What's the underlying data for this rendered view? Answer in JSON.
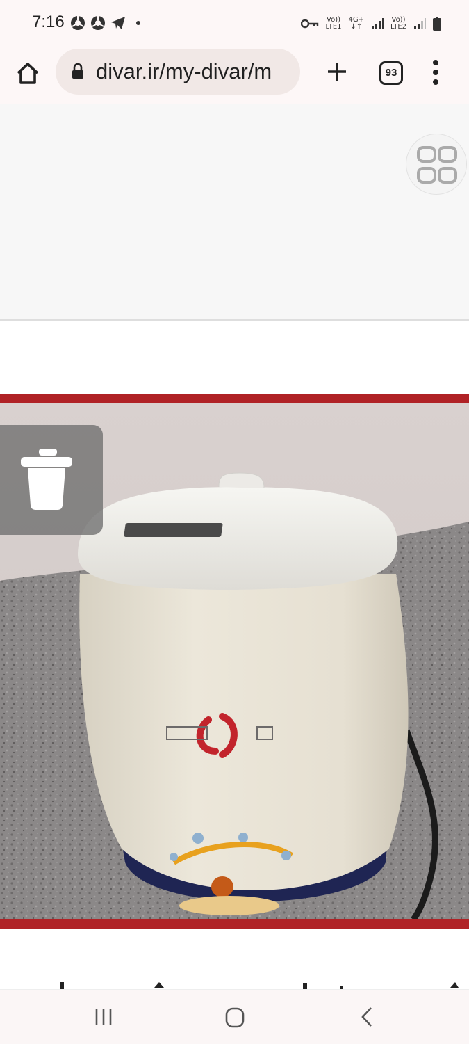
{
  "status_bar": {
    "time": "7:16",
    "net1_top": "Vo))",
    "net1_bottom": "LTE1",
    "net_type_top": "4G+",
    "net_type_bottom": "↓↑",
    "net2_top": "Vo))",
    "net2_bottom": "LTE2",
    "icons": [
      "chrome-icon",
      "chrome-icon",
      "telegram-icon",
      "dot-icon",
      "vpn-key-icon",
      "signal-icon",
      "signal-icon",
      "battery-icon"
    ]
  },
  "browser": {
    "url": "divar.ir/my-divar/m",
    "tab_count": "93",
    "icons": [
      "home-icon",
      "lock-icon",
      "plus-icon",
      "more-vert-icon"
    ]
  },
  "page": {
    "overlay_icon": "grid-icon",
    "delete_icon": "trash-icon",
    "photo_frame_color": "#b02226"
  },
  "nav_bar": {
    "icons": [
      "recent-apps-icon",
      "home-circle-icon",
      "back-icon"
    ]
  }
}
